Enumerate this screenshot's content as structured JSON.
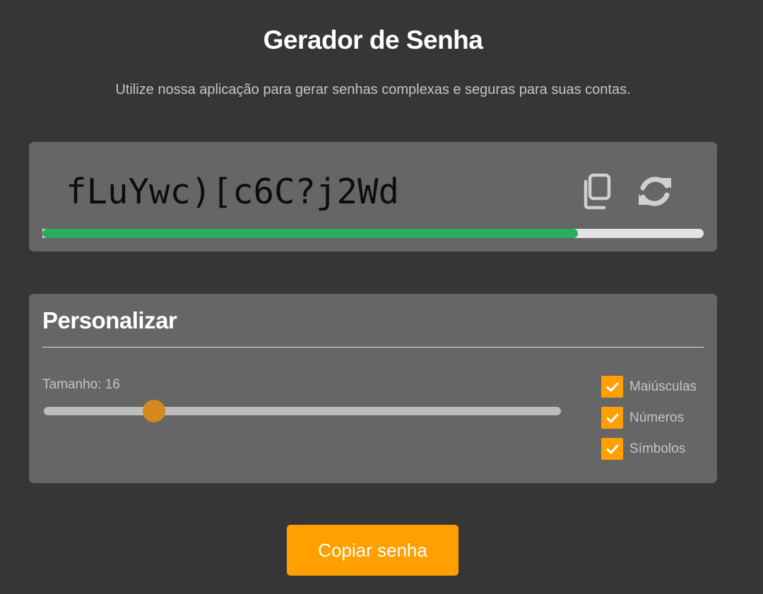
{
  "header": {
    "title": "Gerador de Senha",
    "subtitle": "Utilize nossa aplicação para gerar senhas complexas e seguras para suas contas."
  },
  "password": {
    "value": "fLuYwc)[c6C?j2Wd",
    "strength_fraction": 0.81,
    "strength_color": "#27ae60",
    "copy_icon": "copy-icon",
    "refresh_icon": "refresh-icon"
  },
  "customize": {
    "title": "Personalizar",
    "size_label": "Tamanho: 16",
    "slider": {
      "value": 16,
      "min": 4,
      "max": 64
    },
    "options": [
      {
        "label": "Maiúsculas",
        "checked": true
      },
      {
        "label": "Números",
        "checked": true
      },
      {
        "label": "Símbolos",
        "checked": true
      }
    ]
  },
  "actions": {
    "copy_label": "Copiar senha"
  },
  "colors": {
    "background": "#363636",
    "card": "#666666",
    "accent": "#ff9f00",
    "slider_thumb": "#d48a1c"
  }
}
